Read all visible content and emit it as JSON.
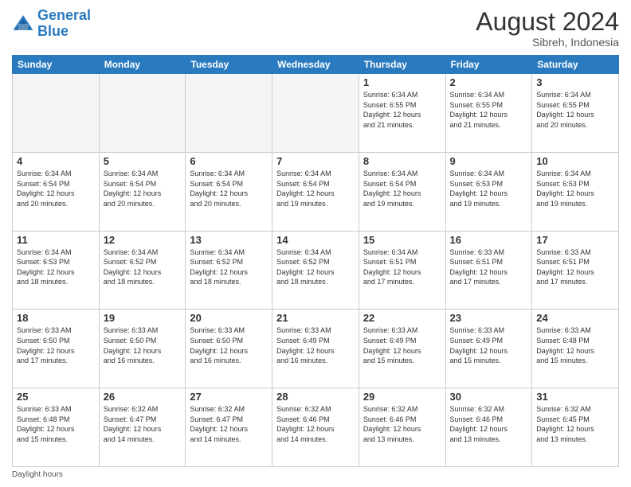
{
  "header": {
    "logo_line1": "General",
    "logo_line2": "Blue",
    "month_year": "August 2024",
    "location": "Sibreh, Indonesia"
  },
  "footer": {
    "note": "Daylight hours"
  },
  "weekdays": [
    "Sunday",
    "Monday",
    "Tuesday",
    "Wednesday",
    "Thursday",
    "Friday",
    "Saturday"
  ],
  "weeks": [
    [
      {
        "day": "",
        "info": ""
      },
      {
        "day": "",
        "info": ""
      },
      {
        "day": "",
        "info": ""
      },
      {
        "day": "",
        "info": ""
      },
      {
        "day": "1",
        "info": "Sunrise: 6:34 AM\nSunset: 6:55 PM\nDaylight: 12 hours\nand 21 minutes."
      },
      {
        "day": "2",
        "info": "Sunrise: 6:34 AM\nSunset: 6:55 PM\nDaylight: 12 hours\nand 21 minutes."
      },
      {
        "day": "3",
        "info": "Sunrise: 6:34 AM\nSunset: 6:55 PM\nDaylight: 12 hours\nand 20 minutes."
      }
    ],
    [
      {
        "day": "4",
        "info": "Sunrise: 6:34 AM\nSunset: 6:54 PM\nDaylight: 12 hours\nand 20 minutes."
      },
      {
        "day": "5",
        "info": "Sunrise: 6:34 AM\nSunset: 6:54 PM\nDaylight: 12 hours\nand 20 minutes."
      },
      {
        "day": "6",
        "info": "Sunrise: 6:34 AM\nSunset: 6:54 PM\nDaylight: 12 hours\nand 20 minutes."
      },
      {
        "day": "7",
        "info": "Sunrise: 6:34 AM\nSunset: 6:54 PM\nDaylight: 12 hours\nand 19 minutes."
      },
      {
        "day": "8",
        "info": "Sunrise: 6:34 AM\nSunset: 6:54 PM\nDaylight: 12 hours\nand 19 minutes."
      },
      {
        "day": "9",
        "info": "Sunrise: 6:34 AM\nSunset: 6:53 PM\nDaylight: 12 hours\nand 19 minutes."
      },
      {
        "day": "10",
        "info": "Sunrise: 6:34 AM\nSunset: 6:53 PM\nDaylight: 12 hours\nand 19 minutes."
      }
    ],
    [
      {
        "day": "11",
        "info": "Sunrise: 6:34 AM\nSunset: 6:53 PM\nDaylight: 12 hours\nand 18 minutes."
      },
      {
        "day": "12",
        "info": "Sunrise: 6:34 AM\nSunset: 6:52 PM\nDaylight: 12 hours\nand 18 minutes."
      },
      {
        "day": "13",
        "info": "Sunrise: 6:34 AM\nSunset: 6:52 PM\nDaylight: 12 hours\nand 18 minutes."
      },
      {
        "day": "14",
        "info": "Sunrise: 6:34 AM\nSunset: 6:52 PM\nDaylight: 12 hours\nand 18 minutes."
      },
      {
        "day": "15",
        "info": "Sunrise: 6:34 AM\nSunset: 6:51 PM\nDaylight: 12 hours\nand 17 minutes."
      },
      {
        "day": "16",
        "info": "Sunrise: 6:33 AM\nSunset: 6:51 PM\nDaylight: 12 hours\nand 17 minutes."
      },
      {
        "day": "17",
        "info": "Sunrise: 6:33 AM\nSunset: 6:51 PM\nDaylight: 12 hours\nand 17 minutes."
      }
    ],
    [
      {
        "day": "18",
        "info": "Sunrise: 6:33 AM\nSunset: 6:50 PM\nDaylight: 12 hours\nand 17 minutes."
      },
      {
        "day": "19",
        "info": "Sunrise: 6:33 AM\nSunset: 6:50 PM\nDaylight: 12 hours\nand 16 minutes."
      },
      {
        "day": "20",
        "info": "Sunrise: 6:33 AM\nSunset: 6:50 PM\nDaylight: 12 hours\nand 16 minutes."
      },
      {
        "day": "21",
        "info": "Sunrise: 6:33 AM\nSunset: 6:49 PM\nDaylight: 12 hours\nand 16 minutes."
      },
      {
        "day": "22",
        "info": "Sunrise: 6:33 AM\nSunset: 6:49 PM\nDaylight: 12 hours\nand 15 minutes."
      },
      {
        "day": "23",
        "info": "Sunrise: 6:33 AM\nSunset: 6:49 PM\nDaylight: 12 hours\nand 15 minutes."
      },
      {
        "day": "24",
        "info": "Sunrise: 6:33 AM\nSunset: 6:48 PM\nDaylight: 12 hours\nand 15 minutes."
      }
    ],
    [
      {
        "day": "25",
        "info": "Sunrise: 6:33 AM\nSunset: 6:48 PM\nDaylight: 12 hours\nand 15 minutes."
      },
      {
        "day": "26",
        "info": "Sunrise: 6:32 AM\nSunset: 6:47 PM\nDaylight: 12 hours\nand 14 minutes."
      },
      {
        "day": "27",
        "info": "Sunrise: 6:32 AM\nSunset: 6:47 PM\nDaylight: 12 hours\nand 14 minutes."
      },
      {
        "day": "28",
        "info": "Sunrise: 6:32 AM\nSunset: 6:46 PM\nDaylight: 12 hours\nand 14 minutes."
      },
      {
        "day": "29",
        "info": "Sunrise: 6:32 AM\nSunset: 6:46 PM\nDaylight: 12 hours\nand 13 minutes."
      },
      {
        "day": "30",
        "info": "Sunrise: 6:32 AM\nSunset: 6:46 PM\nDaylight: 12 hours\nand 13 minutes."
      },
      {
        "day": "31",
        "info": "Sunrise: 6:32 AM\nSunset: 6:45 PM\nDaylight: 12 hours\nand 13 minutes."
      }
    ]
  ]
}
